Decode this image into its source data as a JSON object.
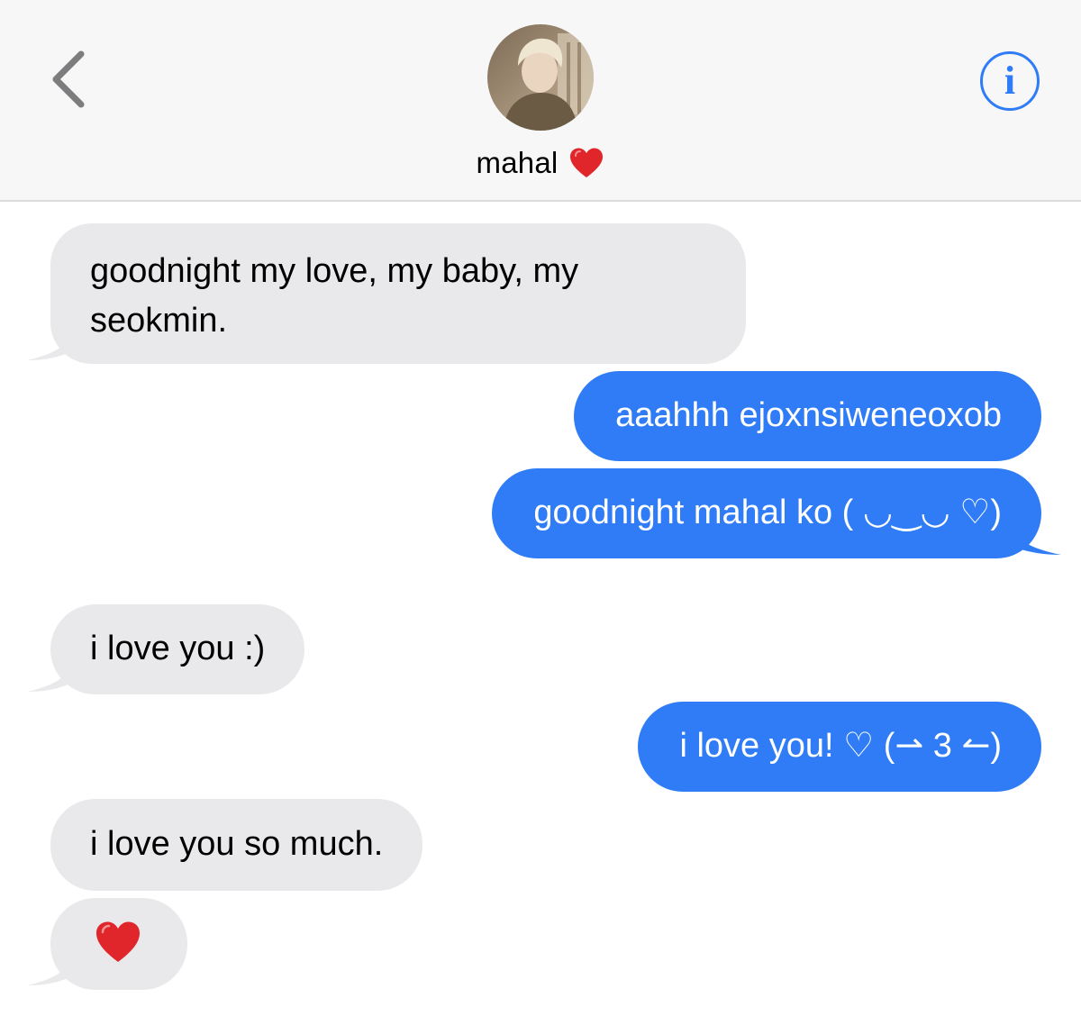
{
  "header": {
    "contact_name": "mahal",
    "back_icon": "chevron-left-icon",
    "info_icon": "info-icon",
    "info_glyph": "i",
    "heart_icon": "red-heart-icon",
    "accent_color": "#2f7cf6"
  },
  "messages": [
    {
      "direction": "incoming",
      "text": "goodnight my love, my baby, my seokmin."
    },
    {
      "direction": "outgoing",
      "text": "aaahhh ejoxnsiweneoxob"
    },
    {
      "direction": "outgoing",
      "text": "goodnight mahal ko ( ◡‿◡ ♡)"
    },
    {
      "direction": "incoming",
      "text": "i love you :)"
    },
    {
      "direction": "outgoing",
      "text": "i love you! ♡ (⇀ 3 ↼)"
    },
    {
      "direction": "incoming",
      "text": "i love you so much."
    },
    {
      "direction": "incoming",
      "text": "",
      "emoji": "red-heart-icon"
    }
  ],
  "colors": {
    "incoming_bubble": "#e9e9eb",
    "outgoing_bubble": "#2f7cf6",
    "header_bg": "#f7f7f7"
  }
}
